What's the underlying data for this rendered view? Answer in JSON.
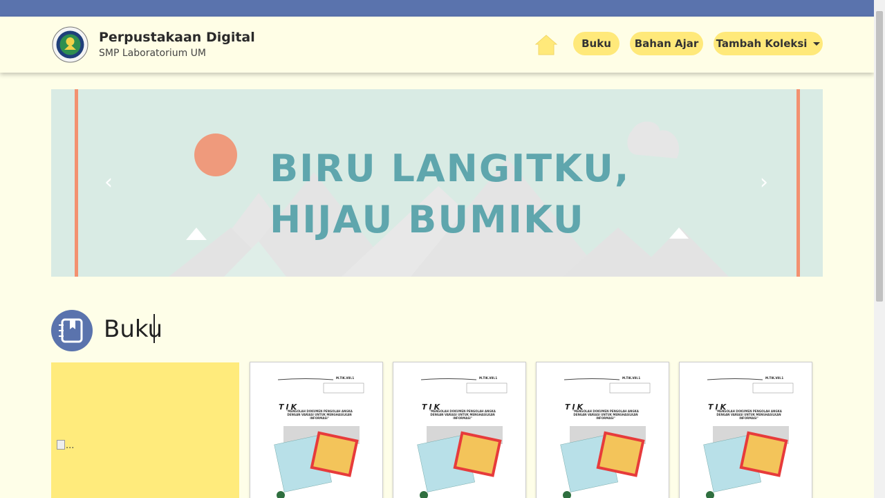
{
  "brand": {
    "title": "Perpustakaan Digital",
    "subtitle": "SMP Laboratorium UM"
  },
  "nav": {
    "home_icon": "home-icon",
    "items": [
      {
        "label": "Buku"
      },
      {
        "label": "Bahan Ajar"
      },
      {
        "label": "Tambah Koleksi"
      }
    ]
  },
  "carousel": {
    "line1": "BIRU LANGITKU,",
    "line2": "HIJAU BUMIKU",
    "prev_icon": "‹",
    "next_icon": "›"
  },
  "section": {
    "title": "Buku",
    "icon": "address-book-icon"
  },
  "first_card": {
    "broken_alt": "..."
  },
  "books": [
    {
      "subject": "TIK",
      "code": "M.TIK.VIII.1",
      "heading": "\"MENGOLAH DOKUMEN PENGOLAH ANGKA DENGAN VARIASI UNTUK MENGHASILKAN INFORMASI\""
    },
    {
      "subject": "TIK",
      "code": "M.TIK.VIII.1",
      "heading": "\"MENGOLAH DOKUMEN PENGOLAH ANGKA DENGAN VARIASI UNTUK MENGHASILKAN INFORMASI\""
    },
    {
      "subject": "TIK",
      "code": "M.TIK.VIII.1",
      "heading": "\"MENGOLAH DOKUMEN PENGOLAH ANGKA DENGAN VARIASI UNTUK MENGHASILKAN INFORMASI\""
    },
    {
      "subject": "TIK",
      "code": "M.TIK.VIII.1",
      "heading": "\"MENGOLAH DOKUMEN PENGOLAH ANGKA DENGAN VARIASI UNTUK MENGHASILKAN INFORMASI\""
    }
  ],
  "colors": {
    "top_strip": "#5a73ad",
    "background": "#fefee8",
    "pill": "#ffe97a",
    "banner_text": "#5fa6ad"
  }
}
